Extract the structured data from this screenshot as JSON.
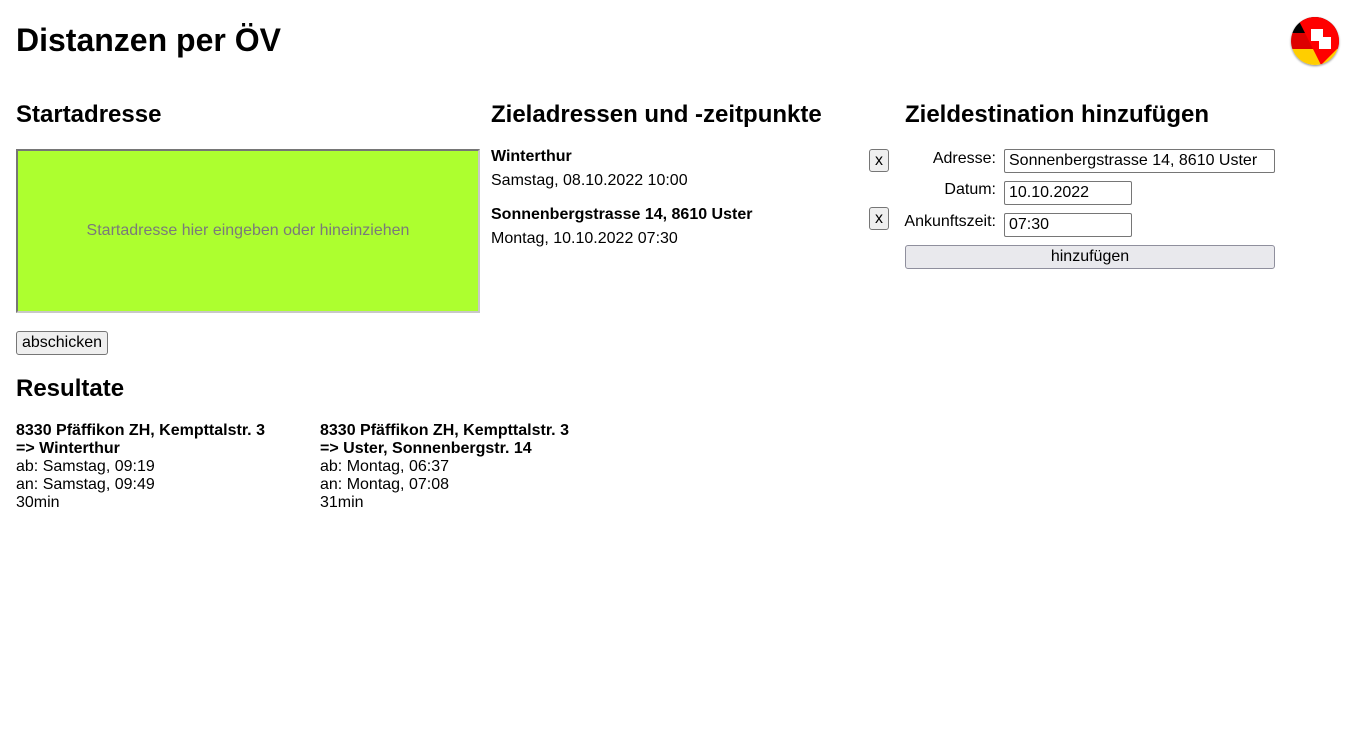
{
  "page_title": "Distanzen per ÖV",
  "language_toggle": {
    "icon": "flag-de-ch-icon",
    "colors": {
      "black": "#000000",
      "red": "#dd0000",
      "gold": "#ffce00",
      "swiss_red": "#ff0000"
    }
  },
  "start": {
    "heading": "Startadresse",
    "placeholder": "Startadresse hier eingeben oder hineinziehen",
    "dropzone_color": "#adff2f",
    "submit_label": "abschicken"
  },
  "destinations": {
    "heading": "Zieladressen und -zeitpunkte",
    "items": [
      {
        "name": "Winterthur",
        "datetime": "Samstag, 08.10.2022 10:00",
        "remove_label": "x"
      },
      {
        "name": "Sonnenbergstrasse 14, 8610 Uster",
        "datetime": "Montag, 10.10.2022 07:30",
        "remove_label": "x"
      }
    ]
  },
  "add_form": {
    "heading": "Zieldestination hinzufügen",
    "address_label": "Adresse:",
    "address_value": "Sonnenbergstrasse 14, 8610 Uster",
    "date_label": "Datum:",
    "date_value": "10.10.2022",
    "time_label": "Ankunftszeit:",
    "time_value": "07:30",
    "submit_label": "hinzufügen"
  },
  "results": {
    "heading": "Resultate",
    "items": [
      {
        "from": "8330 Pfäffikon ZH, Kempttalstr. 3",
        "to": "=> Winterthur",
        "departure": "ab: Samstag, 09:19",
        "arrival": "an: Samstag, 09:49",
        "duration": "30min"
      },
      {
        "from": "8330 Pfäffikon ZH, Kempttalstr. 3",
        "to": "=> Uster, Sonnenbergstr. 14",
        "departure": "ab: Montag, 06:37",
        "arrival": "an: Montag, 07:08",
        "duration": "31min"
      }
    ]
  }
}
